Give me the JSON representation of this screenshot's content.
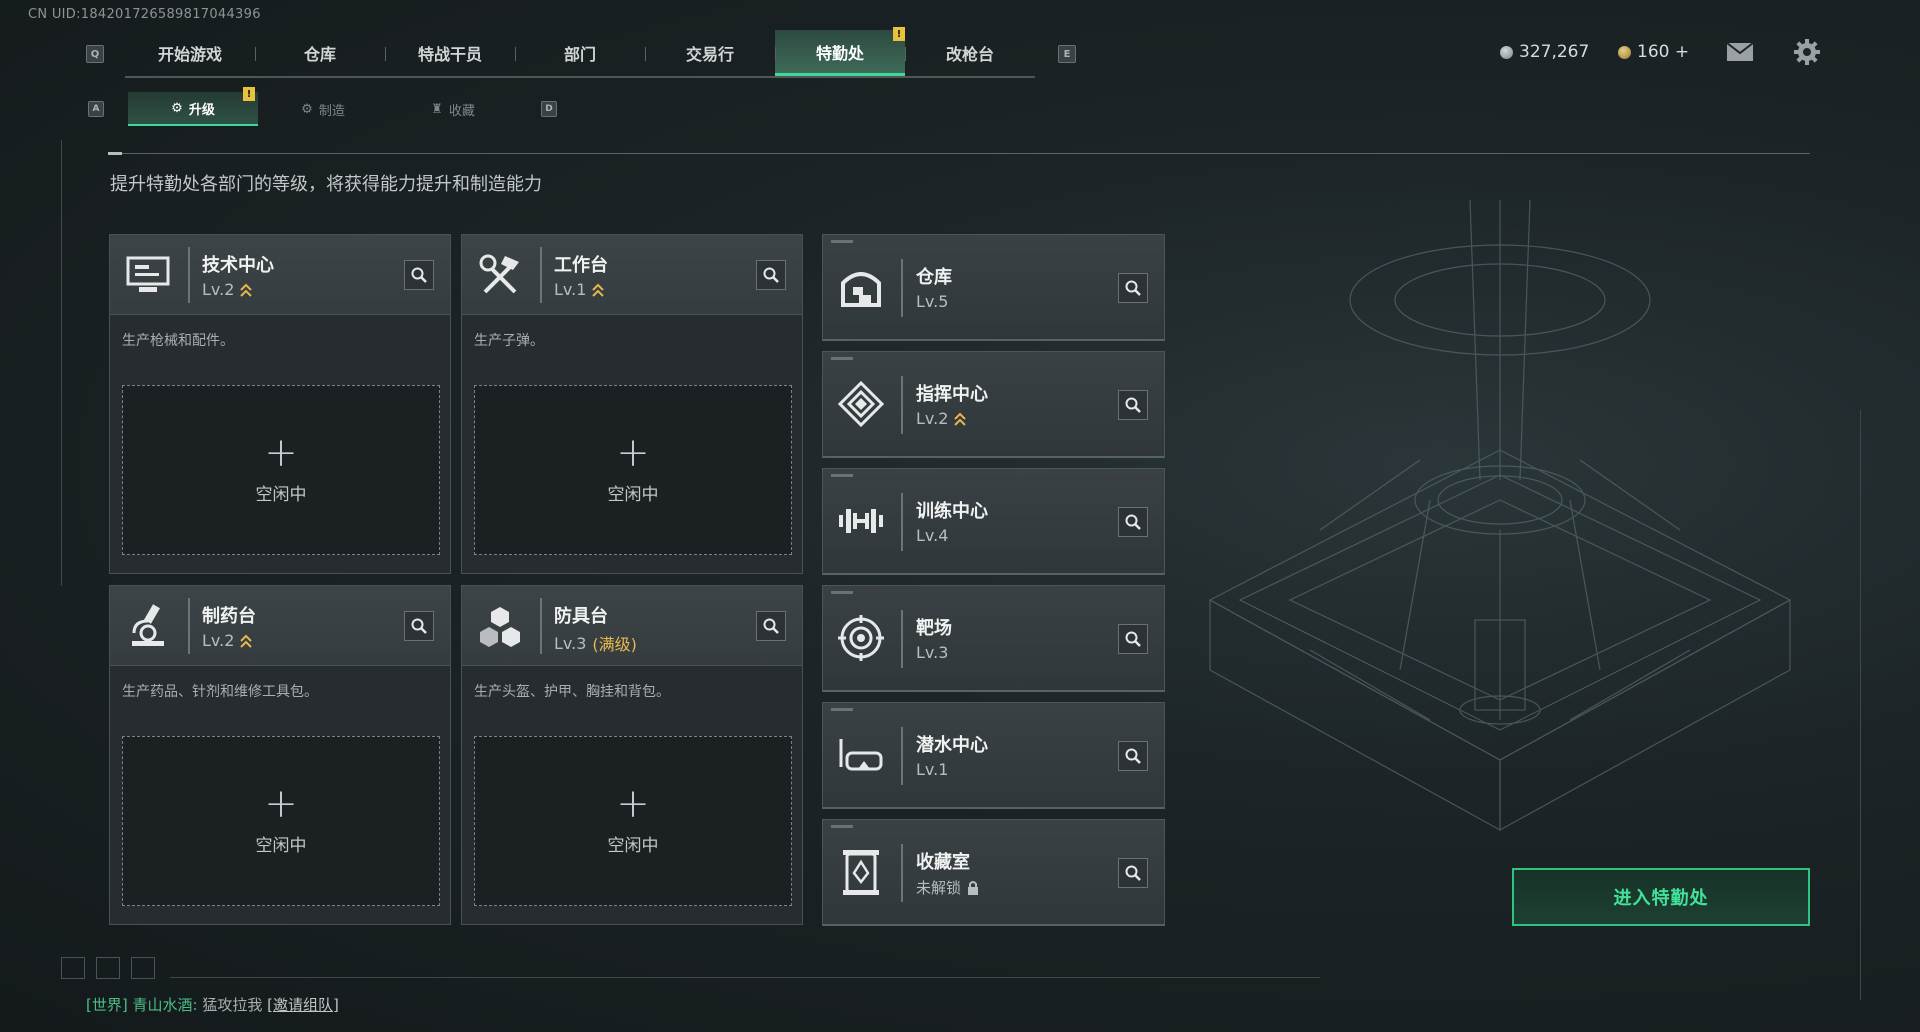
{
  "uid": "CN UID:184201726589817044396",
  "nav": {
    "left_key": "Q",
    "right_key": "E",
    "tabs": [
      {
        "label": "开始游戏"
      },
      {
        "label": "仓库"
      },
      {
        "label": "特战干员"
      },
      {
        "label": "部门"
      },
      {
        "label": "交易行"
      },
      {
        "label": "特勤处",
        "active": true
      },
      {
        "label": "改枪台"
      }
    ],
    "alert": "!"
  },
  "currency": {
    "coins": "327,267",
    "bonds": "160 +"
  },
  "subnav": {
    "left_key": "A",
    "right_key": "D",
    "tabs": [
      {
        "label": "升级",
        "active": true
      },
      {
        "label": "制造"
      },
      {
        "label": "收藏"
      }
    ],
    "alert": "!"
  },
  "subtitle": "提升特勤处各部门的等级，将获得能力提升和制造能力",
  "big_cards": [
    {
      "name": "技术中心",
      "level": "Lv.2",
      "desc": "生产枪械和配件。",
      "slot_status": "空闲中",
      "icon": "monitor-icon"
    },
    {
      "name": "工作台",
      "level": "Lv.1",
      "desc": "生产子弹。",
      "slot_status": "空闲中",
      "icon": "tools-icon"
    },
    {
      "name": "制药台",
      "level": "Lv.2",
      "desc": "生产药品、针剂和维修工具包。",
      "slot_status": "空闲中",
      "icon": "microscope-icon"
    },
    {
      "name": "防具台",
      "level": "Lv.3",
      "max_label": "(满级)",
      "desc": "生产头盔、护甲、胸挂和背包。",
      "slot_status": "空闲中",
      "icon": "cubes-icon"
    }
  ],
  "small_cards": [
    {
      "name": "仓库",
      "level": "Lv.5",
      "icon": "warehouse-icon"
    },
    {
      "name": "指挥中心",
      "level": "Lv.2",
      "icon": "command-icon"
    },
    {
      "name": "训练中心",
      "level": "Lv.4",
      "icon": "dumbbell-icon"
    },
    {
      "name": "靶场",
      "level": "Lv.3",
      "icon": "target-icon"
    },
    {
      "name": "潜水中心",
      "level": "Lv.1",
      "icon": "dive-mask-icon"
    },
    {
      "name": "收藏室",
      "level": "未解锁",
      "icon": "collection-icon",
      "locked": true
    }
  ],
  "enter_button": "进入特勤处",
  "chat": {
    "channel": "[世界]",
    "user": "青山水酒:",
    "message": "猛攻拉我",
    "action": "[邀请组队]"
  },
  "colors": {
    "accent_green": "#3fd89a",
    "alert_yellow": "#e8c23b",
    "upgrade_yellow": "#e6b94c"
  }
}
